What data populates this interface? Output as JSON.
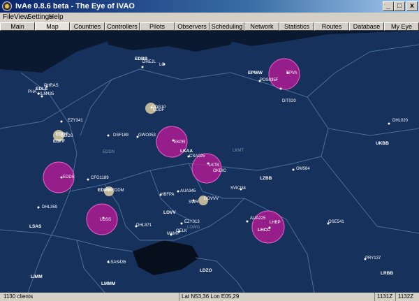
{
  "window": {
    "title": "IvAe 0.8.6 beta - The Eye of IVAO",
    "min": "_",
    "max": "□",
    "close": "x"
  },
  "menu": [
    "File",
    "View",
    "Settings",
    "Help"
  ],
  "tabs": [
    "Main",
    "Map",
    "Countries",
    "Controllers",
    "Pilots",
    "Observers",
    "Scheduling",
    "Network",
    "Statistics",
    "Routes",
    "Database",
    "My Eye"
  ],
  "active_tab": "Map",
  "status": {
    "clients": "1130 clients",
    "position": "Lat N53,36 Lon E05,29",
    "time1": "1131Z",
    "time2": "1132Z"
  },
  "colors": {
    "sea": "#0a1830",
    "land": "#16315b",
    "border": "#4a6ea0",
    "highlight_zone": "#c2189a",
    "atis_zone": "#e8d8a8"
  },
  "map": {
    "countries": [
      "LZBB",
      "UKBB",
      "LOVV",
      "LSAS",
      "LHCC",
      "LDZO",
      "LRBB",
      "LIMM",
      "LMMM",
      "EDBB",
      "EDFF",
      "EPWW"
    ],
    "airports": [
      "EPVA",
      "EKPR",
      "LKAA",
      "LKTB",
      "EDDS",
      "LOSS",
      "LHBP",
      "EDFF",
      "EDDF",
      "EDMM",
      "EDDM"
    ],
    "labels": [
      "EDBB",
      "DHEJL",
      "LO",
      "EPWW",
      "EPVA",
      "POS035F",
      "DIT020",
      "PHRAS",
      "EDLE",
      "PHA",
      "KLM435",
      "EZY341",
      "EDDF",
      "EDDS",
      "EDFF",
      "DOG10",
      "EDDF",
      "DHL020",
      "UKBB",
      "DSF189",
      "GWO053",
      "EKPR",
      "LKAA",
      "EDDN",
      "CSA025",
      "LKMT",
      "LKTB",
      "OKDIC",
      "LZBB",
      "OM584",
      "EDDS",
      "CFG1189",
      "EDMM",
      "EDDM",
      "SVK234",
      "DOVVV",
      "HBFPA",
      "AUA345",
      "SWR",
      "LOVV",
      "DHL359",
      "LSAS",
      "LOSS",
      "DHL871",
      "EZY013",
      "MAMT",
      "OELK",
      "LOWG",
      "AUA225",
      "LHBP",
      "LHCC",
      "OSE541",
      "LSAS435",
      "PRY137",
      "LDZO",
      "LMMM",
      "LIMM",
      "LRBB"
    ]
  }
}
